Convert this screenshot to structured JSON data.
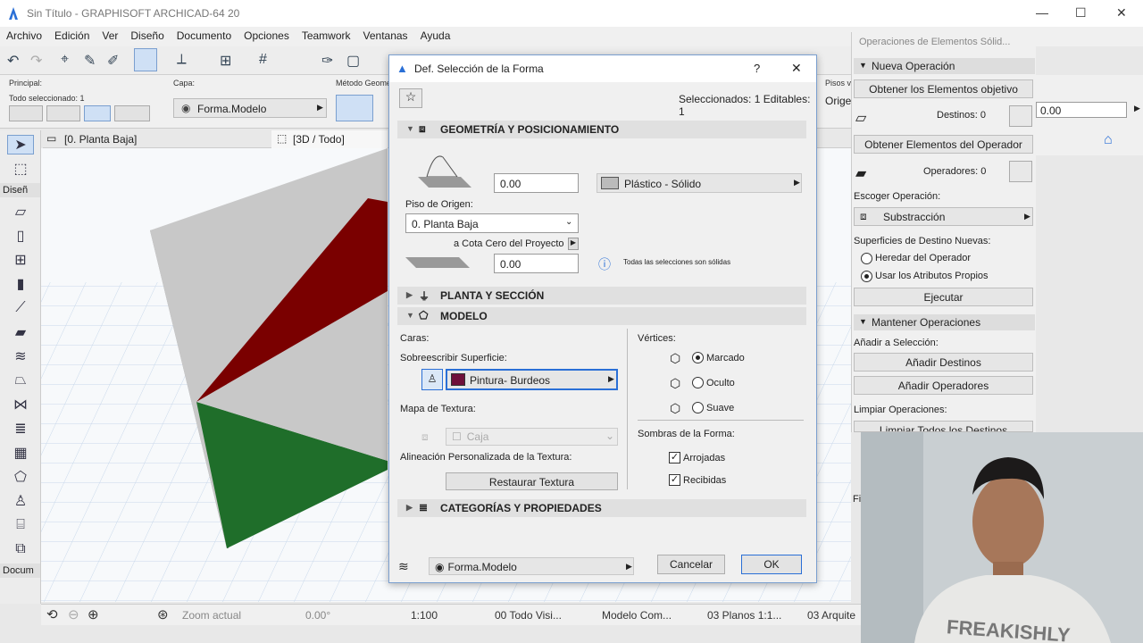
{
  "window": {
    "title": "Sin Título - GRAPHISOFT ARCHICAD-64 20",
    "minimize": "—",
    "maximize": "☐",
    "close": "✕"
  },
  "menu": [
    "Archivo",
    "Edición",
    "Ver",
    "Diseño",
    "Documento",
    "Opciones",
    "Teamwork",
    "Ventanas",
    "Ayuda"
  ],
  "infobox": {
    "principal_label": "Principal:",
    "selected_label": "Todo seleccionado: 1",
    "layer_label": "Capa:",
    "layer_value": "Forma.Modelo",
    "geometry_method_label": "Método Geome",
    "floors_label": "Pisos vi",
    "origin_label": "Orige",
    "origin_value": "0.00"
  },
  "tabs": {
    "plan": "[0. Planta Baja]",
    "view3d": "[3D / Todo]"
  },
  "toolbox": {
    "design_label": "Diseñ",
    "document_label": "Docum"
  },
  "statusbar": {
    "zoom_label": "Zoom actual",
    "angle": "0.00°",
    "scale": "1:100",
    "layer_combo": "00 Todo Visi...",
    "model_view": "Modelo Com...",
    "pen_set": "03 Planos 1:1...",
    "renovation": "03 Arquite"
  },
  "dialog": {
    "title": "Def. Selección de la Forma",
    "help": "?",
    "close": "✕",
    "selected_info": "Seleccionados: 1 Editables: 1",
    "geometry_section": "GEOMETRÍA Y POSICIONAMIENTO",
    "height_value": "0.00",
    "material_value": "Plástico - Sólido",
    "home_story_label": "Piso de Origen:",
    "home_story_value": "0. Planta Baja",
    "zero_level_label": "a Cota Cero del Proyecto",
    "offset_value": "0.00",
    "solid_note": "Todas las selecciones son sólidas",
    "plan_section": "PLANTA Y SECCIÓN",
    "model_section": "MODELO",
    "faces_label": "Caras:",
    "override_label": "Sobreescribir Superficie:",
    "surface_value": "Pintura- Burdeos",
    "surface_color": "#6e0f3a",
    "texture_map_label": "Mapa de Textura:",
    "texture_map_value": "Caja",
    "texture_align_label": "Alineación Personalizada de la Textura:",
    "restore_texture": "Restaurar Textura",
    "vertices_label": "Vértices:",
    "vertex_options": [
      "Marcado",
      "Oculto",
      "Suave"
    ],
    "vertex_selected": "Marcado",
    "shadows_label": "Sombras de la Forma:",
    "cast_shadows": "Arrojadas",
    "receive_shadows": "Recibidas",
    "categories_section": "CATEGORÍAS Y PROPIEDADES",
    "layer_value": "Forma.Modelo",
    "cancel": "Cancelar",
    "ok": "OK"
  },
  "right_panel": {
    "title": "Operaciones de Elementos Sólid...",
    "new_operation": "Nueva Operación",
    "get_targets": "Obtener los Elementos objetivo",
    "targets_label": "Destinos: 0",
    "get_operators": "Obtener Elementos del Operador",
    "operators_label": "Operadores: 0",
    "choose_operation_label": "Escoger Operación:",
    "operation_value": "Substracción",
    "new_surfaces_label": "Superficies de Destino Nuevas:",
    "inherit_operator": "Heredar del Operador",
    "use_own_attributes": "Usar los Atributos Propios",
    "execute": "Ejecutar",
    "keep_operations": "Mantener Operaciones",
    "add_to_selection_label": "Añadir a Selección:",
    "add_targets": "Añadir Destinos",
    "add_operators": "Añadir Operadores",
    "clear_operations_label": "Limpiar Operaciones:",
    "clear_all_targets": "Limpiar Todos los Destinos",
    "fi_label": "Fi"
  },
  "colors": {
    "wall_red": "#7a0000",
    "wall_green": "#1f6e2a",
    "wall_gray": "#c8c8c8",
    "accent": "#2a6fd6"
  },
  "webcam": {
    "shirt_text": "FREAKISHLY"
  }
}
